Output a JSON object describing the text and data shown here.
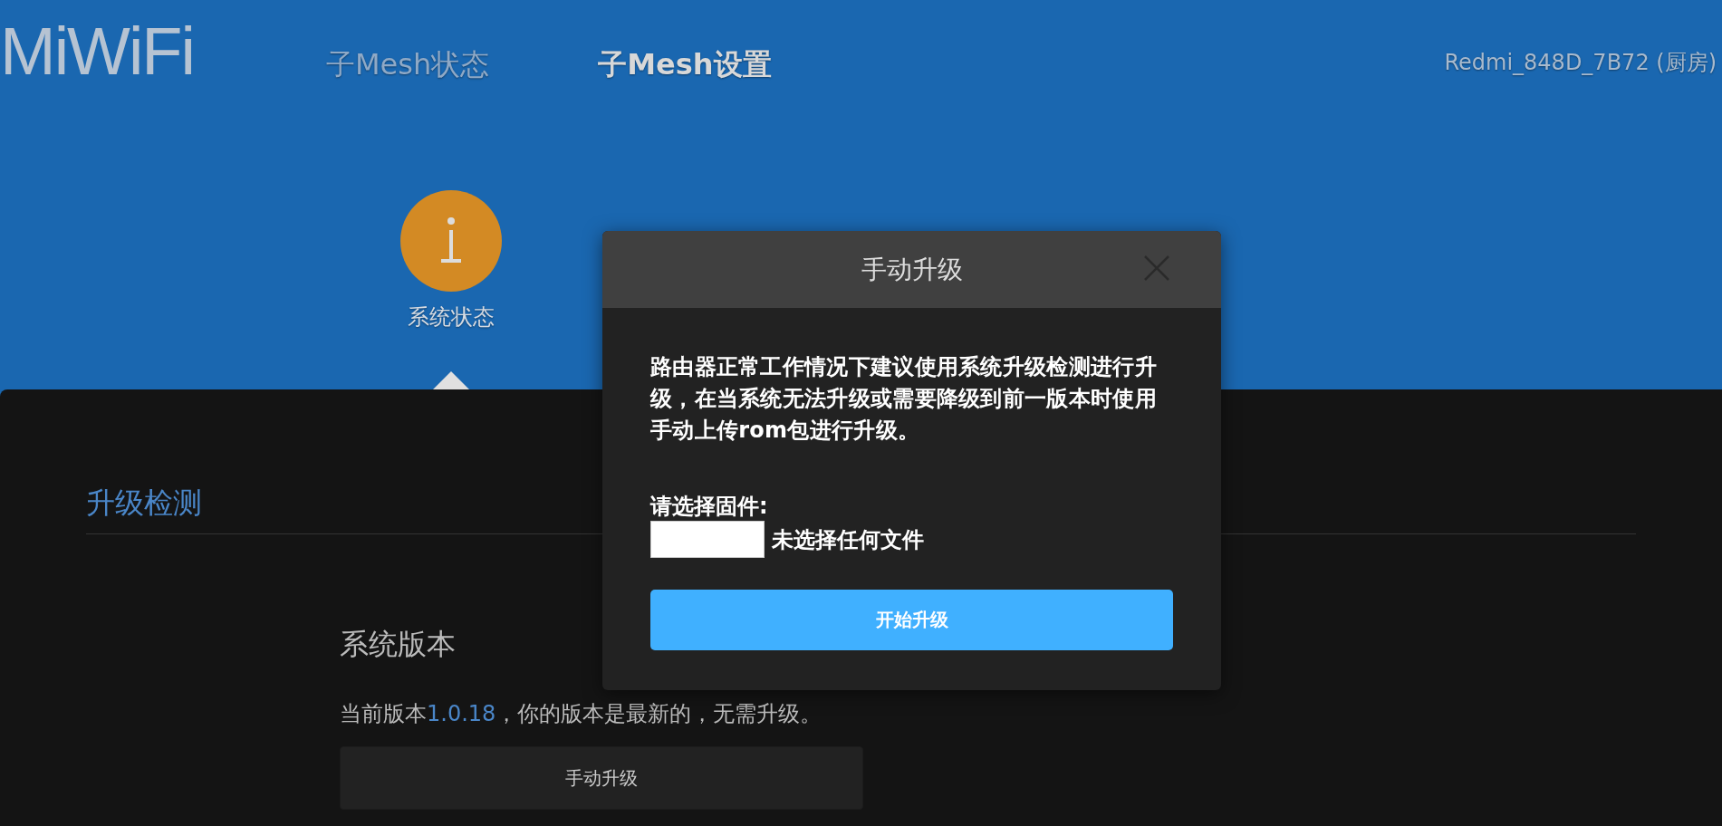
{
  "header": {
    "logo": "MiWiFi",
    "tabs": [
      {
        "label": "子Mesh状态",
        "selected": false
      },
      {
        "label": "子Mesh设置",
        "selected": true
      }
    ],
    "device": "Redmi_848D_7B72 (厨房)"
  },
  "nav": [
    {
      "label": "系统状态",
      "selected": true
    }
  ],
  "section": {
    "title": "升级检测",
    "version_heading": "系统版本",
    "version_label": "当前版本",
    "version": "1.0.18",
    "version_status": "，你的版本是最新的，无需升级。",
    "button": "手动升级"
  },
  "dialog": {
    "title": "手动升级",
    "message": "路由器正常工作情况下建议使用系统升级检测进行升级，在当系统无法升级或需要降级到前一版本时使用手动上传rom包进行升级。",
    "file_label": "请选择固件:",
    "file_status": "未选择任何文件",
    "submit": "开始升级"
  }
}
